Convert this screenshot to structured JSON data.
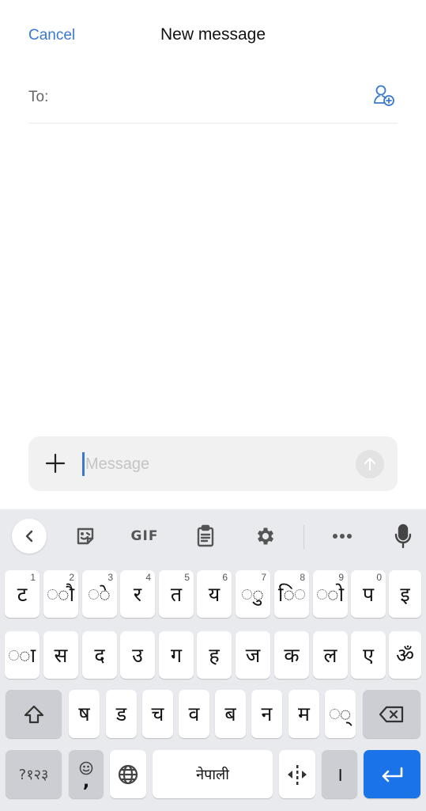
{
  "header": {
    "cancel_label": "Cancel",
    "title": "New message"
  },
  "recipient": {
    "label": "To:",
    "value": "",
    "add_contact_icon": "add-contact-icon"
  },
  "composer": {
    "placeholder": "Message",
    "value": "",
    "attach_icon": "plus-icon",
    "send_icon": "arrow-up-icon"
  },
  "keyboard": {
    "toolbar": {
      "back_icon": "chevron-left-icon",
      "sticker_icon": "sticker-icon",
      "gif_label": "GIF",
      "clipboard_icon": "clipboard-icon",
      "settings_icon": "gear-icon",
      "more_icon": "more-horizontal-icon",
      "mic_icon": "microphone-icon"
    },
    "row1": [
      {
        "char": "ट",
        "hint": "1"
      },
      {
        "char": "ौ",
        "hint": "2",
        "combining": true
      },
      {
        "char": "े",
        "hint": "3",
        "combining": true
      },
      {
        "char": "र",
        "hint": "4"
      },
      {
        "char": "त",
        "hint": "5"
      },
      {
        "char": "य",
        "hint": "6"
      },
      {
        "char": "ु",
        "hint": "7",
        "combining": true
      },
      {
        "char": "ि",
        "hint": "8",
        "combining": true
      },
      {
        "char": "ो",
        "hint": "9",
        "combining": true
      },
      {
        "char": "प",
        "hint": "0"
      },
      {
        "char": "इ",
        "hint": ""
      }
    ],
    "row2": [
      {
        "char": "ा",
        "combining": true
      },
      {
        "char": "स"
      },
      {
        "char": "द"
      },
      {
        "char": "उ"
      },
      {
        "char": "ग"
      },
      {
        "char": "ह"
      },
      {
        "char": "ज"
      },
      {
        "char": "क"
      },
      {
        "char": "ल"
      },
      {
        "char": "ए"
      },
      {
        "char": "ॐ"
      }
    ],
    "row3": [
      {
        "char": "ष"
      },
      {
        "char": "ड"
      },
      {
        "char": "च"
      },
      {
        "char": "व"
      },
      {
        "char": "ब"
      },
      {
        "char": "न"
      },
      {
        "char": "म"
      },
      {
        "char": "्",
        "combining": true
      }
    ],
    "shift_icon": "shift-icon",
    "backspace_icon": "backspace-icon",
    "symbols_label": "?१२३",
    "emoji_icon": "emoji-icon",
    "comma_label": ",",
    "globe_icon": "globe-icon",
    "space_label": "नेपाली",
    "cursor_move_icon": "cursor-move-icon",
    "danda_label": "।",
    "enter_icon": "enter-icon"
  },
  "colors": {
    "accent": "#3a78d0",
    "enter_key": "#1a73e8",
    "keyboard_bg": "#e8eaed",
    "function_key": "#ccced3"
  }
}
